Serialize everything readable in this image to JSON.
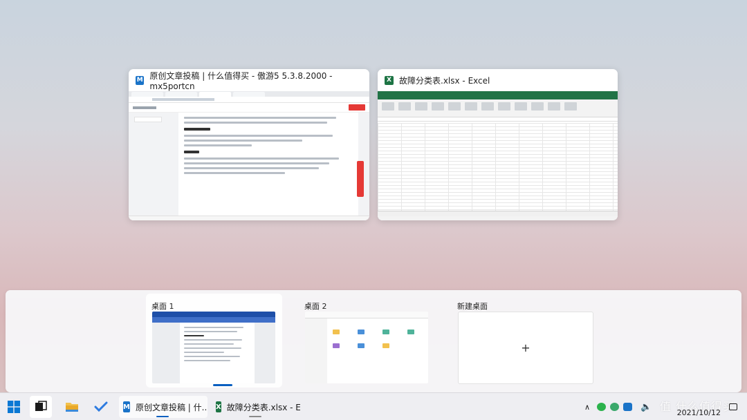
{
  "windows": [
    {
      "title": "原创文章投稿 | 什么值得买 - 傲游5 5.3.8.2000 - mx5portcn",
      "app_icon": "maxthon-browser-icon",
      "accent": "#1a73c8"
    },
    {
      "title": "故障分类表.xlsx - Excel",
      "app_icon": "excel-icon",
      "accent": "#217346"
    }
  ],
  "desktops": {
    "items": [
      {
        "label": "桌面 1",
        "active": true
      },
      {
        "label": "桌面 2",
        "active": false
      }
    ],
    "new_desktop_label": "新建桌面",
    "new_desktop_plus": "+"
  },
  "taskbar": {
    "apps": [
      {
        "label": "原创文章投稿 | 什...",
        "icon": "maxthon-browser-icon",
        "active": true
      },
      {
        "label": "故障分类表.xlsx - E...",
        "icon": "excel-icon",
        "active": false
      }
    ],
    "clock_date": "2021/10/12",
    "watermark": "值 什么值得买"
  },
  "colors": {
    "windows_accent": "#0a5fc0",
    "excel_green": "#217346",
    "browser_red": "#e53935"
  }
}
